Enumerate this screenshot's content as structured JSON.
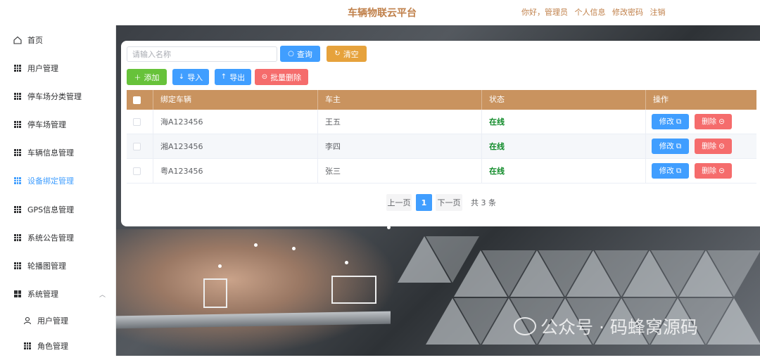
{
  "header": {
    "title": "车辆物联云平台",
    "greeting": "你好，管理员",
    "profile_link": "个人信息",
    "password_link": "修改密码",
    "logout_link": "注销"
  },
  "sidebar": {
    "items": [
      {
        "label": "首页",
        "icon": "home-icon"
      },
      {
        "label": "用户管理",
        "icon": "grid-icon"
      },
      {
        "label": "停车场分类管理",
        "icon": "grid-icon"
      },
      {
        "label": "停车场管理",
        "icon": "grid-icon"
      },
      {
        "label": "车辆信息管理",
        "icon": "grid-icon"
      },
      {
        "label": "设备绑定管理",
        "icon": "grid-icon",
        "active": true
      },
      {
        "label": "GPS信息管理",
        "icon": "grid-icon"
      },
      {
        "label": "系统公告管理",
        "icon": "grid-icon"
      },
      {
        "label": "轮播图管理",
        "icon": "grid-icon"
      },
      {
        "label": "系统管理",
        "icon": "grid4-icon",
        "expanded": true
      },
      {
        "label": "用户管理",
        "icon": "user-icon",
        "sub": true
      },
      {
        "label": "角色管理",
        "icon": "grid-icon",
        "sub": true
      }
    ]
  },
  "search": {
    "placeholder": "请输入名称",
    "value": "",
    "query_label": "查询",
    "reset_label": "清空"
  },
  "toolbar": {
    "add_label": "添加",
    "import_label": "导入",
    "export_label": "导出",
    "batch_delete_label": "批量删除"
  },
  "table": {
    "columns": [
      "绑定车辆",
      "车主",
      "状态",
      "操作"
    ],
    "rows": [
      {
        "vehicle": "海A123456",
        "owner": "王五",
        "status": "在线"
      },
      {
        "vehicle": "湘A123456",
        "owner": "李四",
        "status": "在线"
      },
      {
        "vehicle": "粤A123456",
        "owner": "张三",
        "status": "在线"
      }
    ],
    "edit_label": "修改",
    "delete_label": "删除"
  },
  "pagination": {
    "prev_label": "上一页",
    "current_page": "1",
    "next_label": "下一页",
    "total_label": "共 3 条"
  },
  "watermark": {
    "text": "公众号 · 码蜂窝源码"
  },
  "colors": {
    "accent": "#409eff",
    "header_text": "#c0804a",
    "table_header": "#c9935f",
    "status_online": "#0f8a28",
    "danger": "#f56c6c",
    "warning": "#e6a23c",
    "success": "#67c23a"
  }
}
